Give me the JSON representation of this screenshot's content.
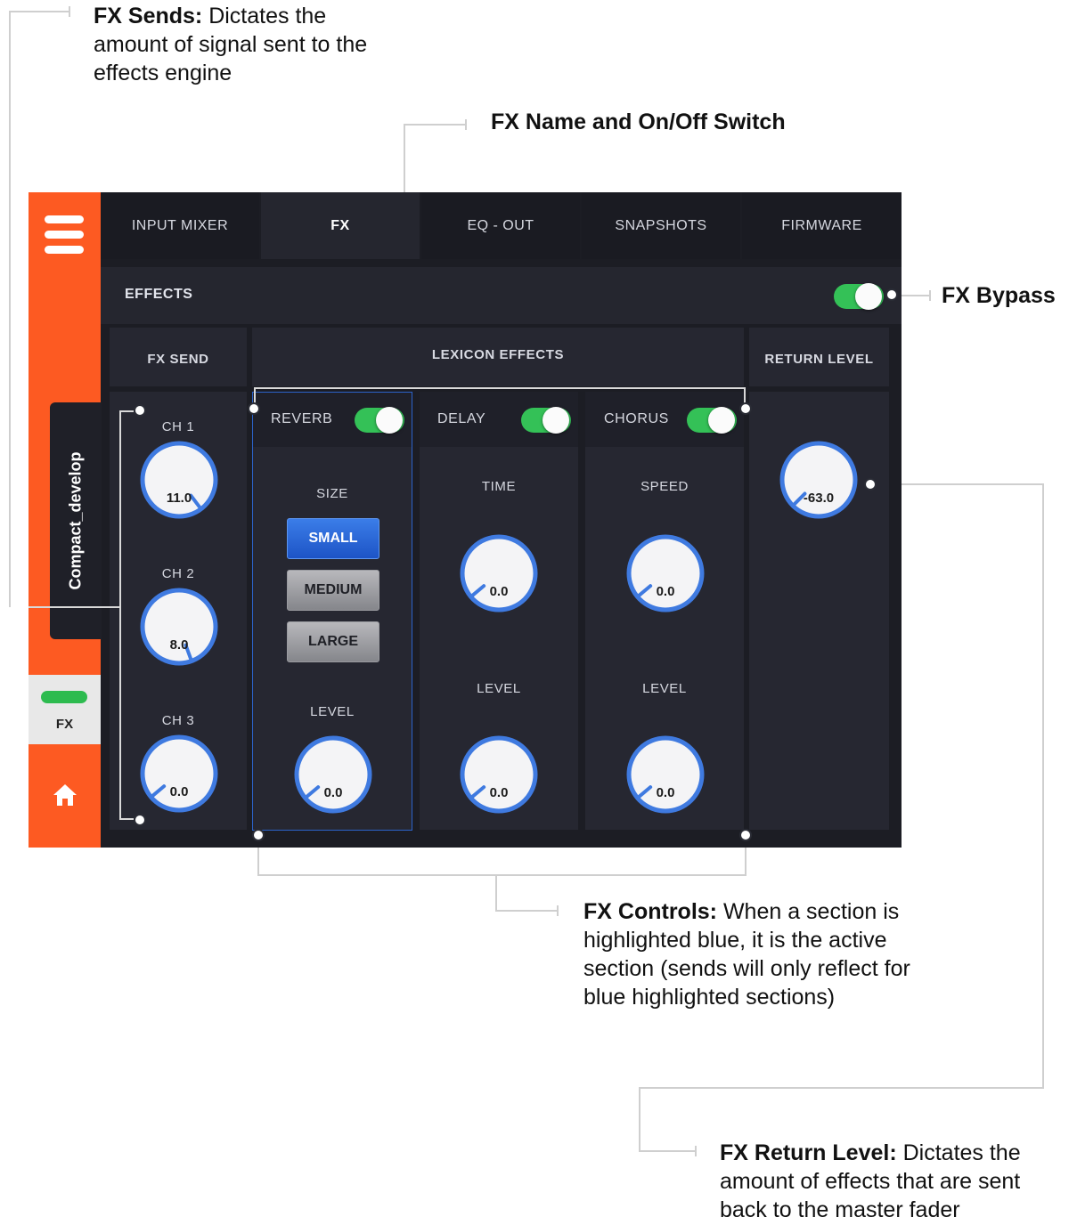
{
  "annotations": {
    "fx_sends": {
      "title": "FX Sends:",
      "text": "Dictates the amount of signal sent to the effects engine"
    },
    "fx_name": {
      "title": "FX Name and On/Off Switch"
    },
    "fx_bypass": {
      "title": "FX Bypass"
    },
    "fx_controls": {
      "title": "FX Controls:",
      "text": "When a section is highlighted blue, it is the active section (sends will only reflect for blue highlighted sections)"
    },
    "fx_return": {
      "title": "FX Return Level:",
      "text": "Dictates the amount of effects that are sent back to the master fader"
    }
  },
  "app": {
    "sidebar": {
      "device": "Compact_develop",
      "fx_button": "FX",
      "accent": "#fd5a22"
    },
    "tabs": [
      {
        "label": "INPUT MIXER",
        "active": false
      },
      {
        "label": "FX",
        "active": true
      },
      {
        "label": "EQ - OUT",
        "active": false
      },
      {
        "label": "SNAPSHOTS",
        "active": false
      },
      {
        "label": "FIRMWARE",
        "active": false
      }
    ],
    "effects_label": "EFFECTS",
    "bypass_on": true,
    "columns": {
      "send": "FX SEND",
      "effects": "LEXICON EFFECTS",
      "return": "RETURN LEVEL"
    },
    "sends": [
      {
        "label": "CH 1",
        "value": "11.0"
      },
      {
        "label": "CH 2",
        "value": "8.0"
      },
      {
        "label": "CH 3",
        "value": "0.0"
      }
    ],
    "reverb": {
      "name": "REVERB",
      "on": true,
      "size_label": "SIZE",
      "sizes": [
        "SMALL",
        "MEDIUM",
        "LARGE"
      ],
      "selected_size": "SMALL",
      "level_label": "LEVEL",
      "level": "0.0"
    },
    "delay": {
      "name": "DELAY",
      "on": true,
      "time_label": "TIME",
      "time": "0.0",
      "level_label": "LEVEL",
      "level": "0.0"
    },
    "chorus": {
      "name": "CHORUS",
      "on": true,
      "speed_label": "SPEED",
      "speed": "0.0",
      "level_label": "LEVEL",
      "level": "0.0"
    },
    "return_level": "-63.0",
    "colors": {
      "toggle_on": "#34c157",
      "knob_ring": "#3f7ae0",
      "selected_button": "#2a63d6"
    }
  }
}
